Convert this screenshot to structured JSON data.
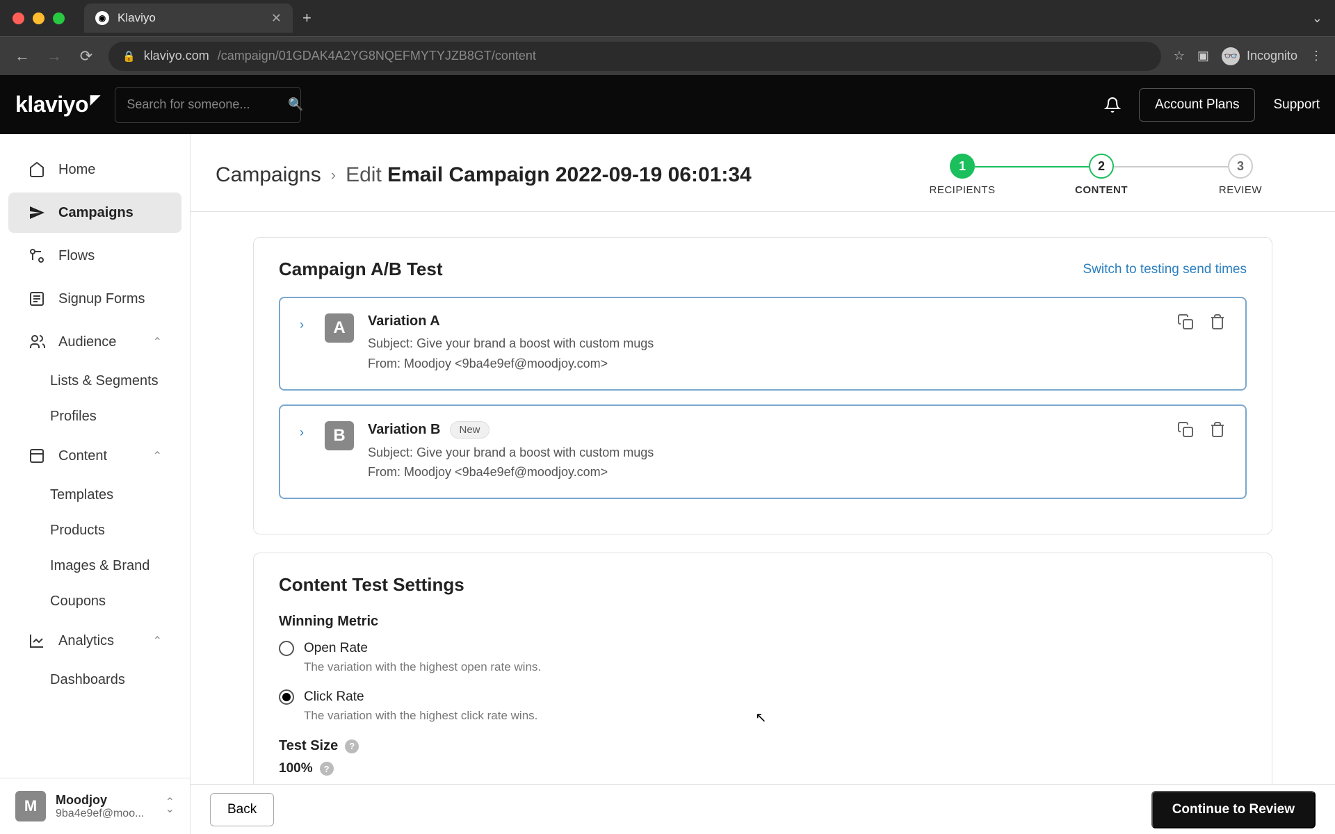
{
  "browser": {
    "tab_title": "Klaviyo",
    "url_host": "klaviyo.com",
    "url_path": "/campaign/01GDAK4A2YG8NQEFMYTYJZB8GT/content",
    "incognito_label": "Incognito"
  },
  "header": {
    "logo": "klaviyo",
    "search_placeholder": "Search for someone...",
    "account_plans": "Account Plans",
    "support": "Support"
  },
  "sidebar": {
    "items": [
      {
        "label": "Home",
        "icon": "home"
      },
      {
        "label": "Campaigns",
        "icon": "send",
        "active": true
      },
      {
        "label": "Flows",
        "icon": "flows"
      },
      {
        "label": "Signup Forms",
        "icon": "forms"
      },
      {
        "label": "Audience",
        "icon": "audience",
        "expandable": true
      },
      {
        "label": "Content",
        "icon": "content",
        "expandable": true
      },
      {
        "label": "Analytics",
        "icon": "analytics",
        "expandable": true
      }
    ],
    "audience_sub": [
      "Lists & Segments",
      "Profiles"
    ],
    "content_sub": [
      "Templates",
      "Products",
      "Images & Brand",
      "Coupons"
    ],
    "analytics_sub": [
      "Dashboards"
    ],
    "account": {
      "initial": "M",
      "name": "Moodjoy",
      "email": "9ba4e9ef@moo..."
    }
  },
  "breadcrumb": {
    "root": "Campaigns",
    "edit": "Edit",
    "title": "Email Campaign 2022-09-19 06:01:34"
  },
  "stepper": [
    {
      "num": "1",
      "label": "RECIPIENTS",
      "state": "done"
    },
    {
      "num": "2",
      "label": "CONTENT",
      "state": "current"
    },
    {
      "num": "3",
      "label": "REVIEW",
      "state": ""
    }
  ],
  "abtest": {
    "title": "Campaign A/B Test",
    "switch_link": "Switch to testing send times",
    "variations": [
      {
        "letter": "A",
        "title": "Variation A",
        "new": false,
        "subject_label": "Subject:",
        "subject": "Give your brand a boost with custom mugs",
        "from_label": "From:",
        "from": "Moodjoy <9ba4e9ef@moodjoy.com>"
      },
      {
        "letter": "B",
        "title": "Variation B",
        "new": true,
        "new_label": "New",
        "subject_label": "Subject:",
        "subject": "Give your brand a boost with custom mugs",
        "from_label": "From:",
        "from": "Moodjoy <9ba4e9ef@moodjoy.com>"
      }
    ]
  },
  "settings": {
    "title": "Content Test Settings",
    "winning_metric_label": "Winning Metric",
    "options": [
      {
        "label": "Open Rate",
        "desc": "The variation with the highest open rate wins.",
        "checked": false
      },
      {
        "label": "Click Rate",
        "desc": "The variation with the highest click rate wins.",
        "checked": true
      }
    ],
    "test_size_label": "Test Size",
    "test_size_value": "100%"
  },
  "footer": {
    "back": "Back",
    "continue": "Continue to Review"
  }
}
